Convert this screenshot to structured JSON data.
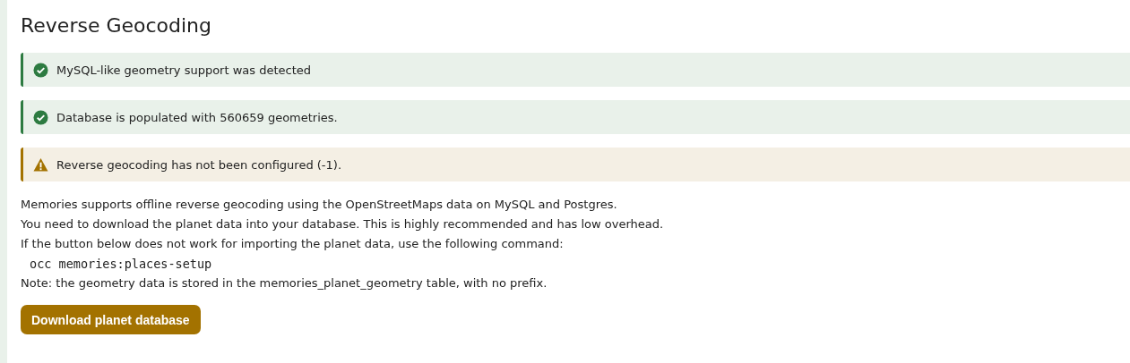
{
  "title": "Reverse Geocoding",
  "notices": [
    {
      "kind": "success",
      "text": "MySQL-like geometry support was detected"
    },
    {
      "kind": "success",
      "text": "Database is populated with 560659 geometries."
    },
    {
      "kind": "warning",
      "text": "Reverse geocoding has not been configured (-1)."
    }
  ],
  "lines": [
    {
      "kind": "text",
      "text": "Memories supports offline reverse geocoding using the OpenStreetMaps data on MySQL and Postgres."
    },
    {
      "kind": "text",
      "text": "You need to download the planet data into your database. This is highly recommended and has low overhead."
    },
    {
      "kind": "text",
      "text": "If the button below does not work for importing the planet data, use the following command:"
    },
    {
      "kind": "code",
      "text": "occ memories:places-setup"
    },
    {
      "kind": "text",
      "text": "Note: the geometry data is stored in the memories_planet_geometry table, with no prefix."
    }
  ],
  "button": "Download planet database"
}
